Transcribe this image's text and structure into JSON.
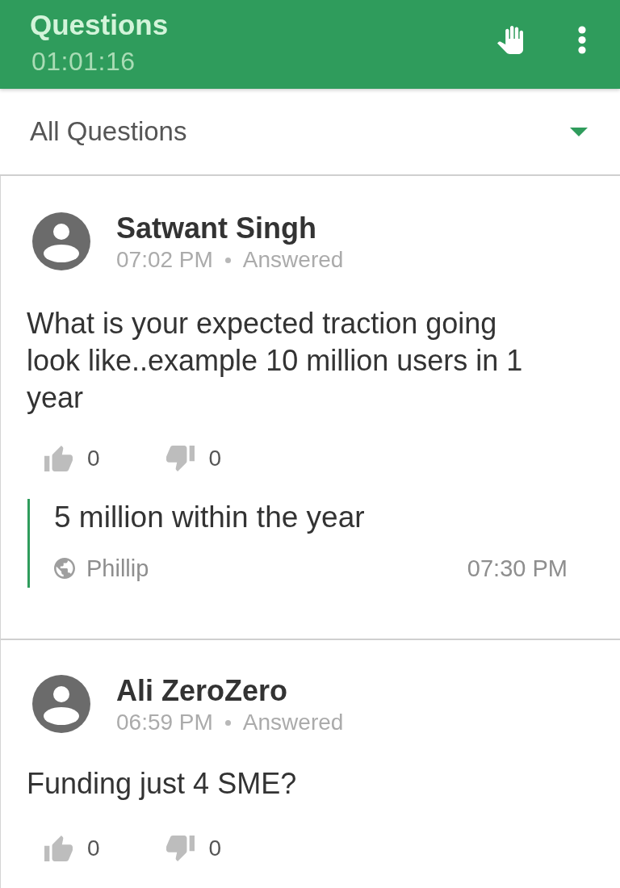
{
  "app_bar": {
    "title": "Questions",
    "timer": "01:01:16"
  },
  "filter": {
    "label": "All Questions"
  },
  "questions": [
    {
      "author": "Satwant Singh",
      "time": "07:02 PM",
      "status": "Answered",
      "text": "What is your expected traction going look like..example 10 million users in 1 year",
      "upvotes": "0",
      "downvotes": "0",
      "answers": [
        {
          "text": "5 million within the year",
          "author": "Phillip",
          "time": "07:30 PM"
        }
      ]
    },
    {
      "author": "Ali ZeroZero",
      "time": "06:59 PM",
      "status": "Answered",
      "text": "Funding just 4 SME?",
      "upvotes": "0",
      "downvotes": "0"
    }
  ]
}
